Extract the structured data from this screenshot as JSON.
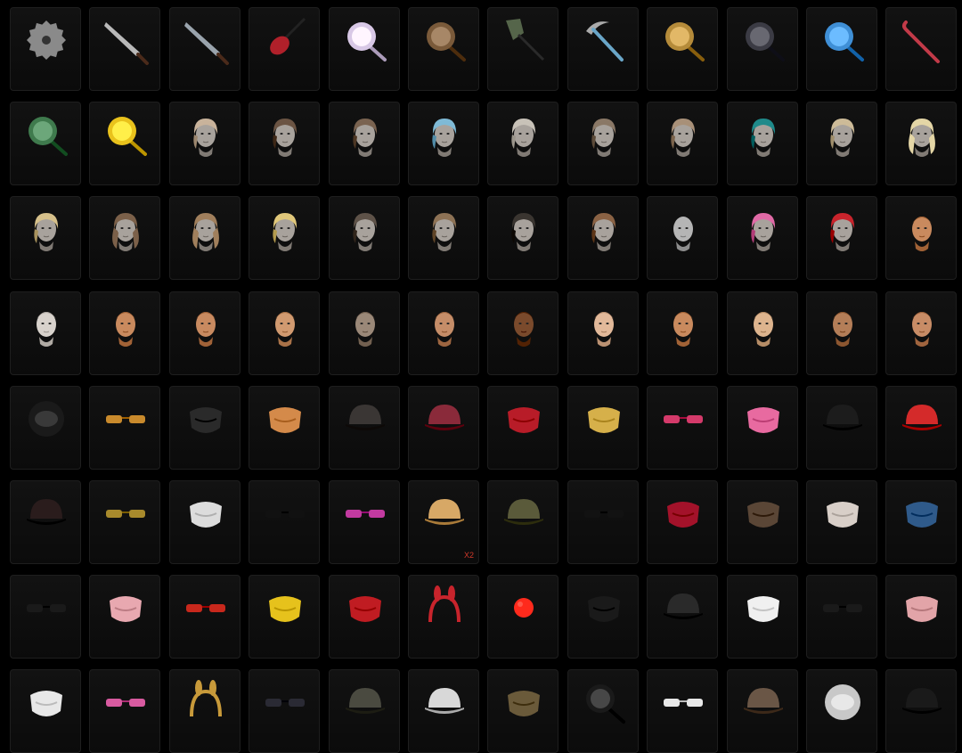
{
  "inventory": {
    "items": [
      {
        "icon": "circular-saw-blade-icon",
        "color": "#8a8a8a",
        "quantity": ""
      },
      {
        "icon": "machete-icon",
        "color": "#b9b9b9",
        "quantity": ""
      },
      {
        "icon": "katana-icon",
        "color": "#9aa4ad",
        "quantity": ""
      },
      {
        "icon": "electric-guitar-icon",
        "color": "#b0202a",
        "quantity": ""
      },
      {
        "icon": "decorated-frying-pan-icon",
        "color": "#d8c8e6",
        "quantity": ""
      },
      {
        "icon": "ornate-frying-pan-icon",
        "color": "#7a5a3a",
        "quantity": ""
      },
      {
        "icon": "shovel-icon",
        "color": "#55654a",
        "quantity": ""
      },
      {
        "icon": "sickle-icon",
        "color": "#6aa6c8",
        "quantity": ""
      },
      {
        "icon": "spiked-golden-pan-icon",
        "color": "#b58b3a",
        "quantity": ""
      },
      {
        "icon": "dark-frying-pan-icon",
        "color": "#3b3b44",
        "quantity": ""
      },
      {
        "icon": "blue-frying-pan-icon",
        "color": "#3f8fd6",
        "quantity": ""
      },
      {
        "icon": "candy-cane-crowbar-icon",
        "color": "#c23a48",
        "quantity": ""
      },
      {
        "icon": "floral-frying-pan-icon",
        "color": "#3f7a4d",
        "quantity": ""
      },
      {
        "icon": "yellow-chick-pan-icon",
        "color": "#e9c21c",
        "quantity": ""
      },
      {
        "icon": "hairstyle-braided-bun-icon",
        "color": "#c9b39b",
        "quantity": ""
      },
      {
        "icon": "hairstyle-short-brown-icon",
        "color": "#6b5443",
        "quantity": ""
      },
      {
        "icon": "hairstyle-slicked-brown-icon",
        "color": "#7a6350",
        "quantity": ""
      },
      {
        "icon": "hairstyle-blue-pink-bob-icon",
        "color": "#7fbad6",
        "quantity": ""
      },
      {
        "icon": "hairstyle-platinum-pixie-icon",
        "color": "#c8c2b8",
        "quantity": ""
      },
      {
        "icon": "hairstyle-curly-short-icon",
        "color": "#8a7866",
        "quantity": ""
      },
      {
        "icon": "hairstyle-braid-ponytail-icon",
        "color": "#a89078",
        "quantity": ""
      },
      {
        "icon": "hairstyle-teal-bob-icon",
        "color": "#1f8a8a",
        "quantity": ""
      },
      {
        "icon": "hairstyle-blonde-bob-icon",
        "color": "#cdbb98",
        "quantity": ""
      },
      {
        "icon": "hairstyle-long-blonde-icon",
        "color": "#e4d6a6",
        "quantity": ""
      },
      {
        "icon": "hairstyle-blonde-lob-icon",
        "color": "#d6c08a",
        "quantity": ""
      },
      {
        "icon": "hairstyle-long-wavy-brown-icon",
        "color": "#7b6049",
        "quantity": ""
      },
      {
        "icon": "hairstyle-wavy-light-brown-icon",
        "color": "#a07f5c",
        "quantity": ""
      },
      {
        "icon": "hairstyle-blonde-bun-icon",
        "color": "#e0c77a",
        "quantity": ""
      },
      {
        "icon": "hairstyle-undercut-icon",
        "color": "#5e5248",
        "quantity": ""
      },
      {
        "icon": "hairstyle-messy-bob-icon",
        "color": "#8d7255",
        "quantity": ""
      },
      {
        "icon": "hairstyle-buzz-fade-icon",
        "color": "#3a3530",
        "quantity": ""
      },
      {
        "icon": "hairstyle-brown-bob-icon",
        "color": "#8a6244",
        "quantity": ""
      },
      {
        "icon": "hairstyle-bald-icon",
        "color": "#b8b8b8",
        "quantity": ""
      },
      {
        "icon": "hairstyle-pink-ponytail-icon",
        "color": "#e06aa6",
        "quantity": ""
      },
      {
        "icon": "hairstyle-red-curly-icon",
        "color": "#c8242c",
        "quantity": ""
      },
      {
        "icon": "face-female-shaved-icon",
        "color": "#c98a5e",
        "quantity": ""
      },
      {
        "icon": "face-clown-makeup-icon",
        "color": "#d8d2cc",
        "quantity": ""
      },
      {
        "icon": "face-female-freckles-icon",
        "color": "#c98a5e",
        "quantity": ""
      },
      {
        "icon": "face-female-icon",
        "color": "#c88a60",
        "quantity": ""
      },
      {
        "icon": "face-female-eyeliner-icon",
        "color": "#d19a70",
        "quantity": ""
      },
      {
        "icon": "face-male-bearded-icon",
        "color": "#9a8878",
        "quantity": ""
      },
      {
        "icon": "face-male-bald-icon",
        "color": "#c58d68",
        "quantity": ""
      },
      {
        "icon": "face-male-dark-icon",
        "color": "#7a4a2c",
        "quantity": ""
      },
      {
        "icon": "face-female-pale-icon",
        "color": "#e2b99a",
        "quantity": ""
      },
      {
        "icon": "face-female-makeup-icon",
        "color": "#c98a5e",
        "quantity": ""
      },
      {
        "icon": "face-female-light-icon",
        "color": "#ddb48e",
        "quantity": ""
      },
      {
        "icon": "face-female-tan-icon",
        "color": "#b47e58",
        "quantity": ""
      },
      {
        "icon": "face-female-red-icon",
        "color": "#c88c66",
        "quantity": ""
      },
      {
        "icon": "black-motorcycle-helmet-icon",
        "color": "#1a1a1a",
        "quantity": ""
      },
      {
        "icon": "gold-visor-icon",
        "color": "#c98a2c",
        "quantity": ""
      },
      {
        "icon": "black-balaclava-icon",
        "color": "#2a2a2a",
        "quantity": ""
      },
      {
        "icon": "wooden-face-mask-icon",
        "color": "#d48a4a",
        "quantity": ""
      },
      {
        "icon": "aviator-cap-goggles-icon",
        "color": "#3a3634",
        "quantity": ""
      },
      {
        "icon": "baseball-cap-red-icon",
        "color": "#8a2a3a",
        "quantity": ""
      },
      {
        "icon": "red-teeth-mask-icon",
        "color": "#b81c28",
        "quantity": ""
      },
      {
        "icon": "bunny-mask-icon",
        "color": "#d6b04a",
        "quantity": ""
      },
      {
        "icon": "heart-sunglasses-icon",
        "color": "#d43a6a",
        "quantity": ""
      },
      {
        "icon": "cat-face-mask-icon",
        "color": "#e86aa0",
        "quantity": ""
      },
      {
        "icon": "black-cat-beanie-icon",
        "color": "#1c1c1c",
        "quantity": ""
      },
      {
        "icon": "striped-bucket-hat-icon",
        "color": "#d42a2a",
        "quantity": ""
      },
      {
        "icon": "black-red-cap-icon",
        "color": "#2a1c1c",
        "quantity": ""
      },
      {
        "icon": "gold-frame-sunglasses-icon",
        "color": "#a88a2c",
        "quantity": ""
      },
      {
        "icon": "zebra-face-mask-icon",
        "color": "#dcdcdc",
        "quantity": ""
      },
      {
        "icon": "black-sunglasses-icon",
        "color": "#111111",
        "quantity": ""
      },
      {
        "icon": "neon-visor-glasses-icon",
        "color": "#c23aa0",
        "quantity": ""
      },
      {
        "icon": "straw-sun-hat-icon",
        "color": "#d7a866",
        "quantity": "X2"
      },
      {
        "icon": "cap-with-headset-icon",
        "color": "#5a5a3a",
        "quantity": ""
      },
      {
        "icon": "wayfarer-sunglasses-icon",
        "color": "#121212",
        "quantity": ""
      },
      {
        "icon": "red-sleep-mask-icon",
        "color": "#a3122a",
        "quantity": ""
      },
      {
        "icon": "plague-gas-mask-icon",
        "color": "#5a4636",
        "quantity": ""
      },
      {
        "icon": "cat-ear-sleep-mask-icon",
        "color": "#d8cfc8",
        "quantity": ""
      },
      {
        "icon": "blue-oni-mask-icon",
        "color": "#2f5a8a",
        "quantity": ""
      },
      {
        "icon": "wrap-sunglasses-icon",
        "color": "#1a1a1a",
        "quantity": ""
      },
      {
        "icon": "pink-eye-mask-icon",
        "color": "#e8a8b0",
        "quantity": ""
      },
      {
        "icon": "red-round-glasses-icon",
        "color": "#c8281c",
        "quantity": ""
      },
      {
        "icon": "yellow-gas-mask-icon",
        "color": "#e6c21c",
        "quantity": ""
      },
      {
        "icon": "red-half-face-mask-icon",
        "color": "#c01c22",
        "quantity": ""
      },
      {
        "icon": "bunny-ears-headband-icon",
        "color": "#c8242c",
        "quantity": ""
      },
      {
        "icon": "red-clown-nose-icon",
        "color": "#ff2a1c",
        "quantity": ""
      },
      {
        "icon": "black-cat-face-mask-icon",
        "color": "#1a1a1a",
        "quantity": ""
      },
      {
        "icon": "dark-baseball-cap-icon",
        "color": "#2a2a2a",
        "quantity": ""
      },
      {
        "icon": "white-cat-face-mask-icon",
        "color": "#f0f0f0",
        "quantity": ""
      },
      {
        "icon": "slim-black-sunglasses-icon",
        "color": "#1a1a1a",
        "quantity": ""
      },
      {
        "icon": "pink-sleep-mask-icon",
        "color": "#e2a4a8",
        "quantity": ""
      },
      {
        "icon": "white-patterned-face-mask-icon",
        "color": "#e8e8e8",
        "quantity": ""
      },
      {
        "icon": "pink-cyber-visor-icon",
        "color": "#d85aa0",
        "quantity": ""
      },
      {
        "icon": "reindeer-antler-headband-icon",
        "color": "#c89a3a",
        "quantity": ""
      },
      {
        "icon": "sport-sunglasses-icon",
        "color": "#2a2a34",
        "quantity": ""
      },
      {
        "icon": "camo-baseball-cap-icon",
        "color": "#4a4a40",
        "quantity": ""
      },
      {
        "icon": "white-baseball-cap-icon",
        "color": "#d8d8d8",
        "quantity": ""
      },
      {
        "icon": "camo-neck-gaiter-icon",
        "color": "#6a5a3a",
        "quantity": ""
      },
      {
        "icon": "panda-headband-icon",
        "color": "#1a1a1a",
        "quantity": ""
      },
      {
        "icon": "white-sport-sunglasses-icon",
        "color": "#e8e8e8",
        "quantity": ""
      },
      {
        "icon": "flat-cap-icon",
        "color": "#6a5646",
        "quantity": ""
      },
      {
        "icon": "astronaut-helmet-icon",
        "color": "#c8c8c8",
        "quantity": ""
      },
      {
        "icon": "black-witch-hat-icon",
        "color": "#1a1a1a",
        "quantity": ""
      }
    ]
  }
}
